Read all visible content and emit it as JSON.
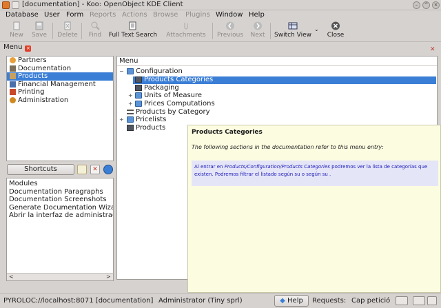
{
  "window": {
    "title": "[documentation] - Koo: OpenObject KDE Client"
  },
  "menubar": [
    "Database",
    "User",
    "Form",
    "Reports",
    "Actions",
    "Browse",
    "Plugins",
    "Window",
    "Help"
  ],
  "toolbar": {
    "new": "New",
    "save": "Save",
    "delete": "Delete",
    "find": "Find",
    "full_text_search": "Full Text Search",
    "attachments": "Attachments",
    "previous": "Previous",
    "next": "Next",
    "switch_view": "Switch View",
    "close": "Close"
  },
  "tab": {
    "label": "Menu"
  },
  "sidebar": {
    "items": [
      {
        "label": "Partners",
        "icon": "partners-icon"
      },
      {
        "label": "Documentation",
        "icon": "documentation-icon"
      },
      {
        "label": "Products",
        "icon": "products-icon"
      },
      {
        "label": "Financial Management",
        "icon": "finance-icon"
      },
      {
        "label": "Printing",
        "icon": "printing-icon"
      },
      {
        "label": "Administration",
        "icon": "administration-icon"
      }
    ],
    "selected_index": 2
  },
  "shortcuts": {
    "button_label": "Shortcuts",
    "items": [
      "Modules",
      "Documentation Paragraphs",
      "Documentation Screenshots",
      "Generate Documentation Wizard",
      "Abrir la interfaz de administración"
    ]
  },
  "tree": {
    "header": "Menu",
    "rows": [
      {
        "label": "Configuration",
        "icon": "folder-icon",
        "expander": "−"
      },
      {
        "label": "Products Categories",
        "icon": "document-icon",
        "expander": ""
      },
      {
        "label": "Packaging",
        "icon": "document-icon",
        "expander": ""
      },
      {
        "label": "Units of Measure",
        "icon": "folder-icon",
        "expander": "+"
      },
      {
        "label": "Prices Computations",
        "icon": "folder-icon",
        "expander": "+"
      },
      {
        "label": "Products by Category",
        "icon": "list-icon",
        "expander": ""
      },
      {
        "label": "Pricelists",
        "icon": "folder-icon",
        "expander": "+"
      },
      {
        "label": "Products",
        "icon": "document-icon",
        "expander": ""
      }
    ],
    "selected_index": 1
  },
  "tooltip": {
    "title": "Products Categories",
    "subtitle": "The following sections in the documentation refer to this menu entry:",
    "body_prefix": "Al entrar en ",
    "body_link": "Products/Configuration/Products Categories",
    "body_suffix": " podremos ver la lista de categorías que existen. Podremos filtrar el listado según su o según su ."
  },
  "statusbar": {
    "connection": "PYROLOC://localhost:8071 [documentation]",
    "user": "Administrator (Tiny sprl)",
    "help": "Help",
    "requests": "Requests:",
    "request_value": "Cap petició"
  },
  "colors": {
    "selection": "#3b7ed6",
    "tooltip_bg": "#fcfce1",
    "tooltip_box": "#e5e5f8",
    "tooltip_text": "#1c1cb8"
  }
}
